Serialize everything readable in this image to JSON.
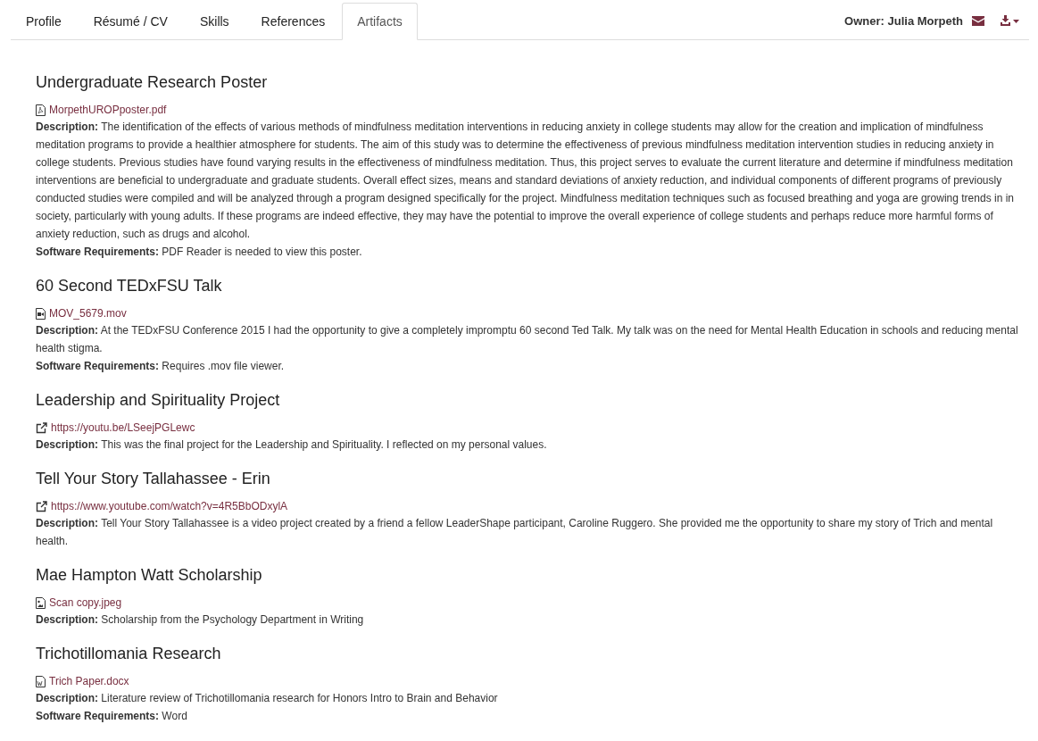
{
  "tabs": [
    {
      "label": "Profile",
      "selected": false
    },
    {
      "label": "Résumé / CV",
      "selected": false
    },
    {
      "label": "Skills",
      "selected": false
    },
    {
      "label": "References",
      "selected": false
    },
    {
      "label": "Artifacts",
      "selected": true
    }
  ],
  "owner": "Owner: Julia Morpeth",
  "artifacts": [
    {
      "title": "Undergraduate Research Poster",
      "file": {
        "kind": "pdf",
        "name": "MorpethUROPposter.pdf"
      },
      "details": [
        "**Description:** The identification of the effects of various methods of mindfulness meditation interventions in reducing anxiety in college students may allow for the creation and implication of mindfulness meditation programs to provide a healthier atmosphere for students. The aim of this study was to determine the effectiveness of previous mindfulness meditation intervention studies in reducing anxiety in college students. Previous studies have found varying results in the effectiveness of mindfulness meditation. Thus, this project serves to evaluate the current literature and determine if mindfulness meditation interventions are beneficial to undergraduate and graduate students. Overall effect sizes, means and standard deviations of anxiety reduction, and individual components of different programs of previously conducted studies were compiled and will be analyzed through a program designed specifically for the project. Mindfulness meditation techniques such as focused breathing and yoga are growing trends in in society, particularly with young adults. If these programs are indeed effective, they may have the potential to improve the overall experience of college students and perhaps reduce more harmful forms of anxiety reduction, such as drugs and alcohol.",
        "**Software Requirements:** PDF Reader is needed to view this poster."
      ]
    },
    {
      "title": "60 Second TEDxFSU Talk",
      "file": {
        "kind": "video",
        "name": "MOV_5679.mov"
      },
      "details": [
        "**Description:** At the TEDxFSU Conference 2015 I had the opportunity to give a completely impromptu 60 second Ted Talk. My talk was on the need for Mental Health Education in schools and reducing mental health stigma.",
        "**Software Requirements:** Requires .mov file viewer."
      ]
    },
    {
      "title": "Leadership and Spirituality Project",
      "file": {
        "kind": "link",
        "name": "https://youtu.be/LSeejPGLewc"
      },
      "details": [
        "**Description:** This was the final project for the Leadership and Spirituality. I reflected on my personal values."
      ]
    },
    {
      "title": "Tell Your Story Tallahassee - Erin",
      "file": {
        "kind": "link",
        "name": "https://www.youtube.com/watch?v=4R5BbODxylA"
      },
      "details": [
        "**Description:** Tell Your Story Tallahassee is a video project created by a friend a fellow LeaderShape participant, Caroline Ruggero. She provided me the opportunity to share my story of Trich and mental health."
      ]
    },
    {
      "title": "Mae Hampton Watt Scholarship",
      "file": {
        "kind": "image",
        "name": "Scan copy.jpeg"
      },
      "details": [
        "**Description:** Scholarship from the Psychology Department in Writing"
      ]
    },
    {
      "title": "Trichotillomania Research",
      "file": {
        "kind": "word",
        "name": "Trich Paper.docx"
      },
      "details": [
        "**Description:** Literature review of Trichotillomania research for Honors Intro to Brain and Behavior",
        "**Software Requirements:** Word"
      ]
    }
  ]
}
